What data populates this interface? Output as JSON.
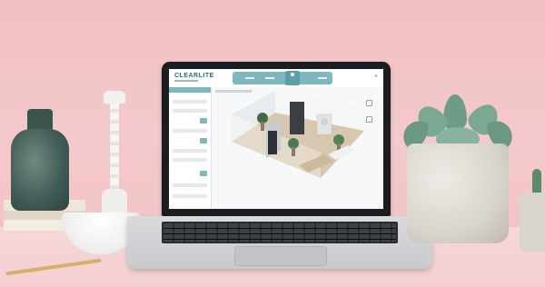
{
  "app": {
    "logo_text": "CLEARLITE",
    "close_glyph": "×"
  },
  "icons": [
    "close-icon"
  ],
  "colors": {
    "accent": "#7fb7bf",
    "accent_dark": "#5e9ea8",
    "wall": "#f2c6c9"
  }
}
